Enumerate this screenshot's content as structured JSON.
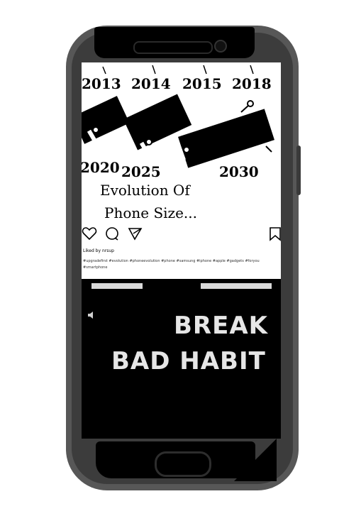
{
  "post": {
    "years_top": [
      "2013",
      "2014",
      "2015",
      "2018"
    ],
    "years_bottom": [
      "2020",
      "2025",
      "2030"
    ],
    "caption_line1": "Evolution Of",
    "caption_line2": "Phone Size...",
    "actions": [
      "heart-icon",
      "comment-icon",
      "share-icon",
      "bookmark-icon"
    ],
    "username": "Liked by nrsup",
    "hashtags": "#upgradefirst #evolution #phoneevolution #phone #samsung #iphone #apple #gadgets #foryou #smartphone"
  },
  "reel": {
    "line1": "BREAK",
    "line2": "BAD HABIT"
  }
}
